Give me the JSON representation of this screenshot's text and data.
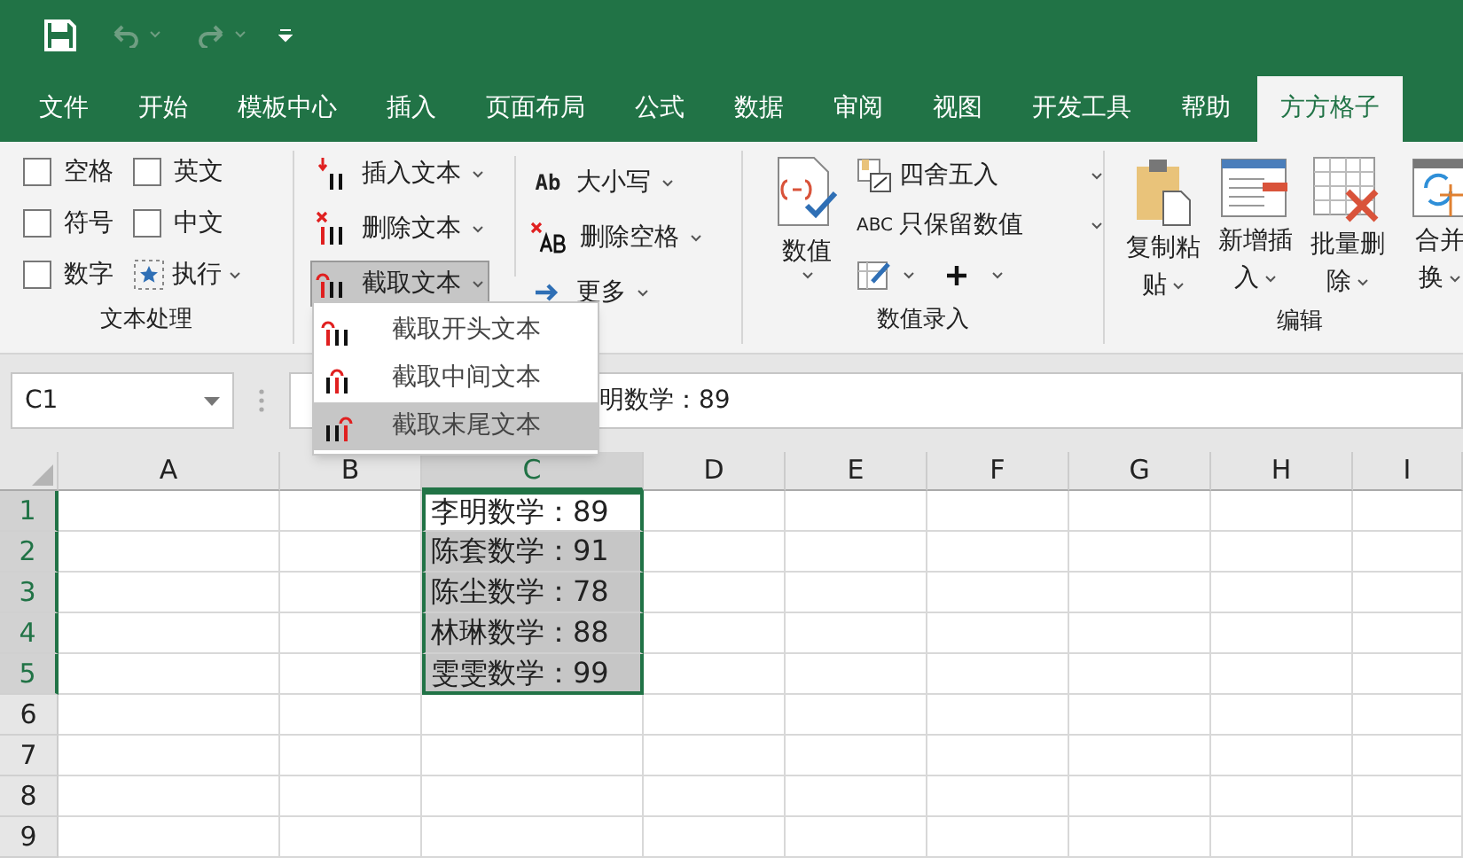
{
  "quick_access": {
    "undo_disabled": true,
    "redo_disabled": true
  },
  "tabs": [
    {
      "label": "文件",
      "selected": false
    },
    {
      "label": "开始",
      "selected": false
    },
    {
      "label": "模板中心",
      "selected": false
    },
    {
      "label": "插入",
      "selected": false
    },
    {
      "label": "页面布局",
      "selected": false
    },
    {
      "label": "公式",
      "selected": false
    },
    {
      "label": "数据",
      "selected": false
    },
    {
      "label": "审阅",
      "selected": false
    },
    {
      "label": "视图",
      "selected": false
    },
    {
      "label": "开发工具",
      "selected": false
    },
    {
      "label": "帮助",
      "selected": false
    },
    {
      "label": "方方格子",
      "selected": true
    }
  ],
  "text_group": {
    "label": "文本处理",
    "items": [
      {
        "kind": "checkbox",
        "label": "空格",
        "checked": false
      },
      {
        "kind": "checkbox",
        "label": "英文",
        "checked": false
      },
      {
        "kind": "checkbox",
        "label": "符号",
        "checked": false
      },
      {
        "kind": "checkbox",
        "label": "中文",
        "checked": false
      },
      {
        "kind": "checkbox",
        "label": "数字",
        "checked": false
      },
      {
        "kind": "button",
        "label": "执行"
      }
    ]
  },
  "text_tools": [
    {
      "kind": "insert",
      "label": "插入文本",
      "pressed": false
    },
    {
      "kind": "delete",
      "label": "删除文本",
      "pressed": false
    },
    {
      "kind": "extract",
      "label": "截取文本",
      "pressed": true
    }
  ],
  "text_tools_2": [
    {
      "kind": "case",
      "label": "大小写",
      "icon_text": "Ab"
    },
    {
      "kind": "trim",
      "label": "删除空格"
    },
    {
      "kind": "more",
      "label": "更多"
    }
  ],
  "number_group": {
    "label": "数值录入",
    "big_button": "数值",
    "round": "四舍五入",
    "keep_numbers": "只保留数值",
    "keep_numbers_icon": "ABC"
  },
  "edit_group": {
    "label": "编辑",
    "buttons": [
      {
        "kind": "paste",
        "line1": "复制粘",
        "line2": "贴"
      },
      {
        "kind": "insert",
        "line1": "新增插",
        "line2": "入"
      },
      {
        "kind": "delete",
        "line1": "批量删",
        "line2": "除"
      },
      {
        "kind": "merge",
        "line1": "合并",
        "line2": "换"
      }
    ]
  },
  "dropdown_menu": [
    {
      "kind": "start",
      "label": "截取开头文本",
      "selected": false
    },
    {
      "kind": "middle",
      "label": "截取中间文本",
      "selected": false
    },
    {
      "kind": "end",
      "label": "截取末尾文本",
      "selected": true
    }
  ],
  "name_box": "C1",
  "formula_value": "明数学：89",
  "columns": [
    {
      "label": "A",
      "selected": false
    },
    {
      "label": "B",
      "selected": false
    },
    {
      "label": "C",
      "selected": true
    },
    {
      "label": "D",
      "selected": false
    },
    {
      "label": "E",
      "selected": false
    },
    {
      "label": "F",
      "selected": false
    },
    {
      "label": "G",
      "selected": false
    },
    {
      "label": "H",
      "selected": false
    },
    {
      "label": "I",
      "selected": false
    }
  ],
  "rows": [
    {
      "label": "1",
      "selected": true,
      "cell": {
        "text": "李明数学：89",
        "active": true
      }
    },
    {
      "label": "2",
      "selected": true,
      "cell": {
        "text": "陈套数学：91",
        "active": false
      }
    },
    {
      "label": "3",
      "selected": true,
      "cell": {
        "text": "陈尘数学：78",
        "active": false
      }
    },
    {
      "label": "4",
      "selected": true,
      "cell": {
        "text": "林琳数学：88",
        "active": false
      }
    },
    {
      "label": "5",
      "selected": true,
      "cell": {
        "text": "雯雯数学：99",
        "active": false
      }
    },
    {
      "label": "6",
      "selected": false
    },
    {
      "label": "7",
      "selected": false
    },
    {
      "label": "8",
      "selected": false
    },
    {
      "label": "9",
      "selected": false
    }
  ]
}
